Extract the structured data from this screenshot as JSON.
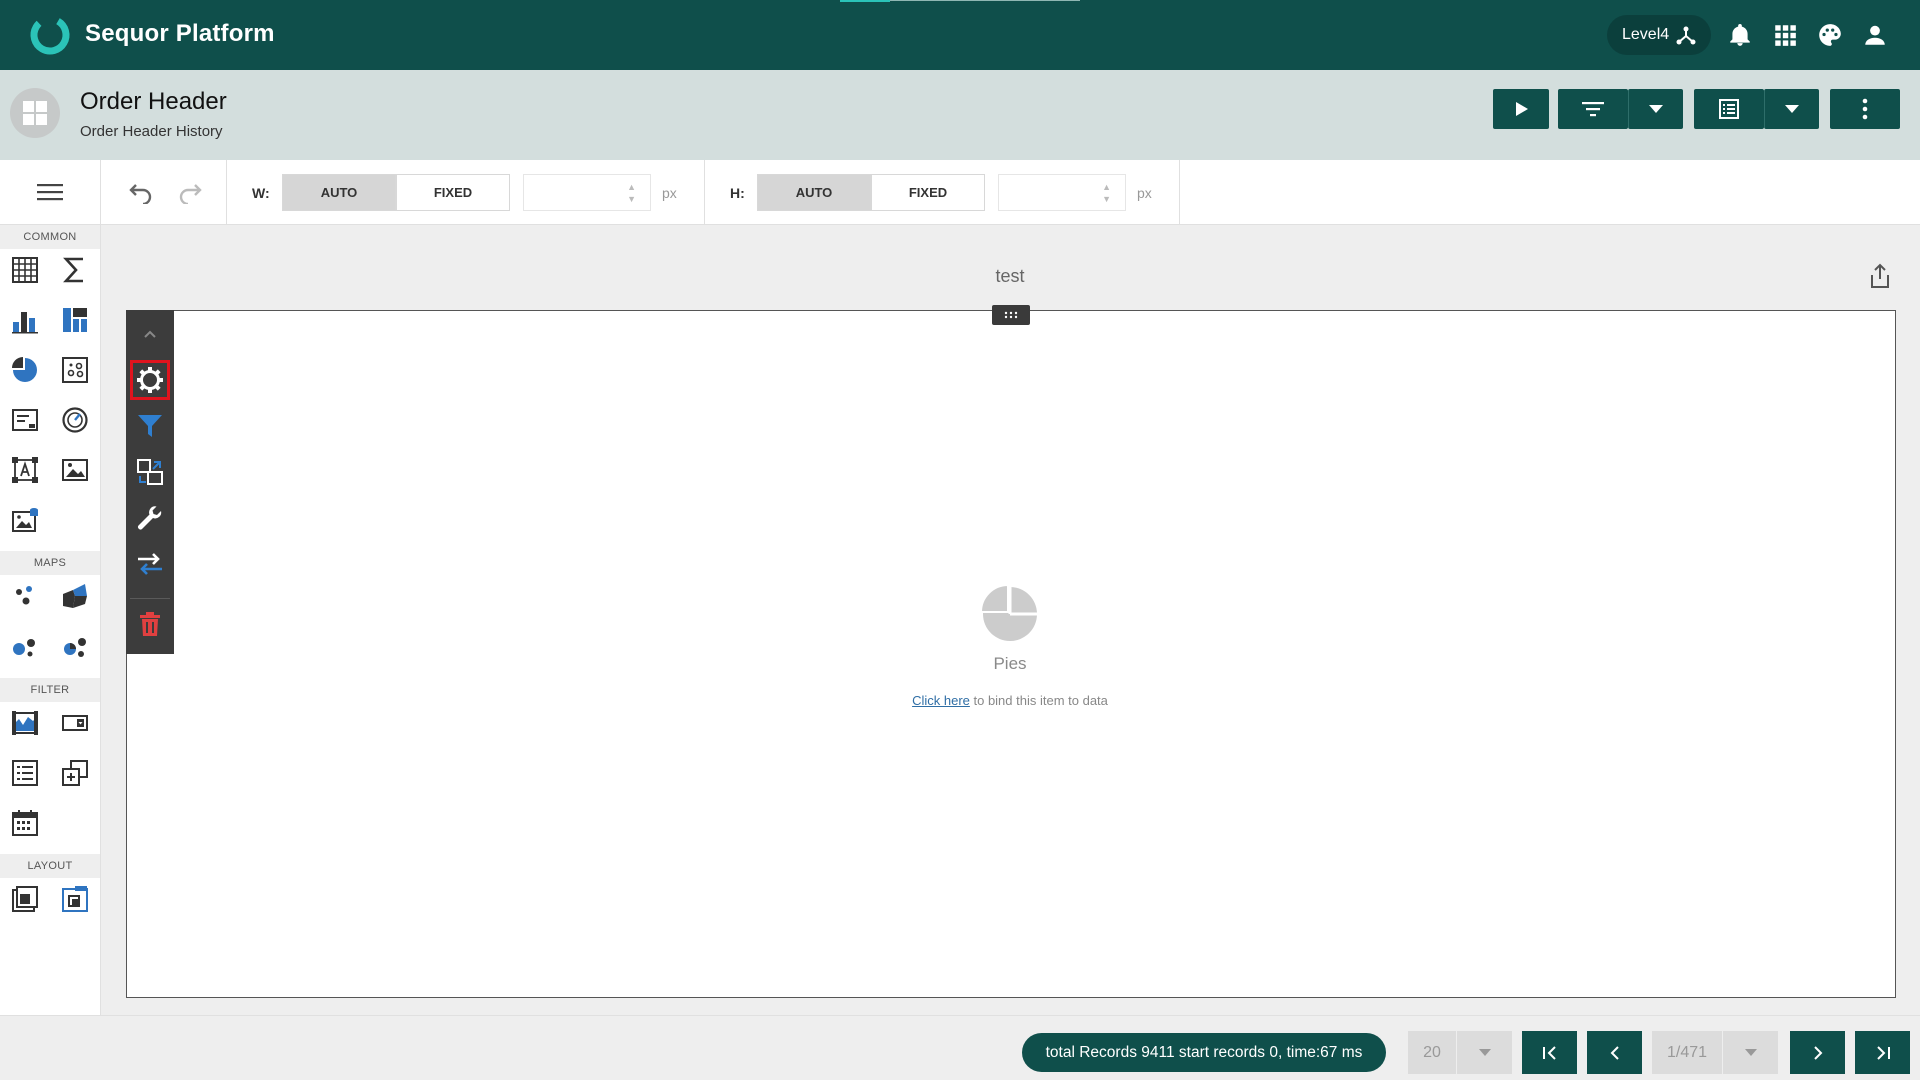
{
  "app": {
    "brand": "Sequor Platform",
    "level": "Level4",
    "accent": "#0f4f4b"
  },
  "page": {
    "title": "Order Header",
    "subtitle": "Order Header History"
  },
  "toolbar": {
    "width_label": "W:",
    "height_label": "H:",
    "auto_label": "AUTO",
    "fixed_label": "FIXED",
    "unit": "px",
    "width_value": "",
    "height_value": ""
  },
  "palette": {
    "sections": [
      "COMMON",
      "MAPS",
      "FILTER",
      "LAYOUT"
    ]
  },
  "canvas": {
    "item_title": "test",
    "placeholder_label": "Pies",
    "bind_link": "Click here",
    "bind_hint": " to bind this item to data"
  },
  "footer": {
    "status": "total Records 9411 start records 0, time:67 ms",
    "page_size": "20",
    "page_indicator": "1/471"
  }
}
